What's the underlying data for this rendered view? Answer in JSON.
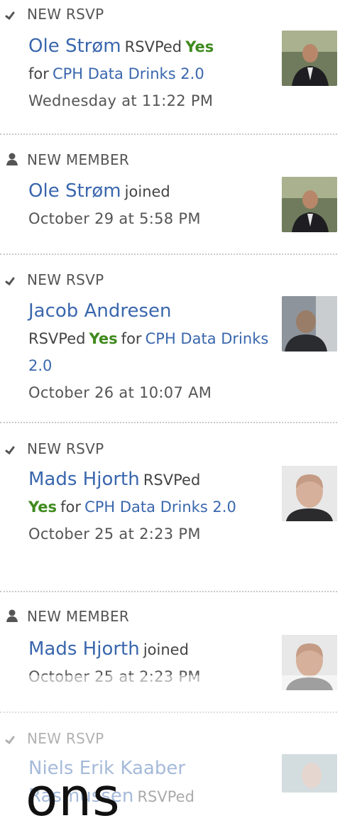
{
  "feed": [
    {
      "type_label": "NEW RSVP",
      "icon": "checkmark-icon",
      "name": "Ole Strøm",
      "verb": "RSVPed",
      "answer": "Yes",
      "prep": "for",
      "event": "CPH Data Drinks 2.0",
      "time": "Wednesday at 11:22 PM"
    },
    {
      "type_label": "NEW MEMBER",
      "icon": "person-icon",
      "name": "Ole Strøm",
      "verb": "joined",
      "time": "October 29 at 5:58 PM"
    },
    {
      "type_label": "NEW RSVP",
      "icon": "checkmark-icon",
      "name": "Jacob Andresen",
      "verb": "RSVPed",
      "answer": "Yes",
      "prep": "for",
      "event": "CPH Data Drinks 2.0",
      "time": "October 26 at 10:07 AM"
    },
    {
      "type_label": "NEW RSVP",
      "icon": "checkmark-icon",
      "name": "Mads Hjorth",
      "verb": "RSVPed",
      "answer": "Yes",
      "prep": "for",
      "event": "CPH Data Drinks 2.0",
      "time": "October 25 at 2:23 PM"
    },
    {
      "type_label": "NEW MEMBER",
      "icon": "person-icon",
      "name": "Mads Hjorth",
      "verb": "joined",
      "time": "October 25 at 2:23 PM"
    },
    {
      "type_label": "NEW RSVP",
      "icon": "checkmark-icon",
      "name_line1": "Niels Erik Kaaber",
      "name_line2": "Rasmussen",
      "verb": "RSVPed"
    }
  ],
  "overlay_text": "ons",
  "colors": {
    "link": "#3a67ad",
    "yes": "#3f8a1e",
    "meta": "#555555",
    "separator": "#c9c9c9"
  }
}
